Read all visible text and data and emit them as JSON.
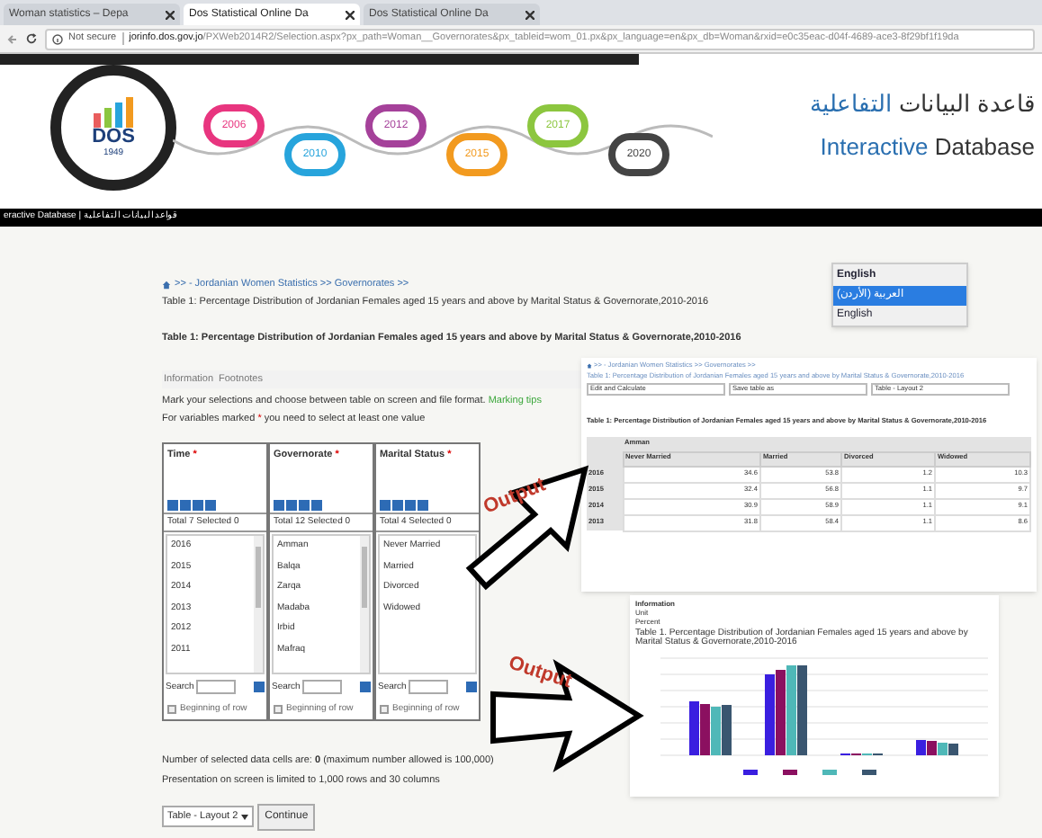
{
  "browser": {
    "tabs": [
      {
        "title": "Woman statistics – Depa",
        "selected": false
      },
      {
        "title": "Dos Statistical Online Da",
        "selected": true
      },
      {
        "title": "Dos Statistical Online Da",
        "selected": false
      }
    ],
    "security": "Not secure",
    "url_host": "jorinfo.dos.gov.jo",
    "url_path": "/PXWeb2014R2/Selection.aspx?px_path=Woman__Governorates&px_tableid=wom_01.px&px_language=en&px_db=Woman&rxid=e0c35eac-d04f-4689-ace3-8f29bf1f19da"
  },
  "banner": {
    "logo_text": "DOS",
    "logo_year": "1949",
    "years": [
      "2006",
      "2010",
      "2012",
      "2015",
      "2017",
      "2020"
    ],
    "title_ar_1": "قاعدة البيانات",
    "title_ar_2": "التفاعلية",
    "title_en_1": "Interactive",
    "title_en_2": "Database"
  },
  "nav_bar": "eractive Database | قواعد البيانات التفاعلية",
  "breadcrumb": ">> - Jordanian Women Statistics >> Governorates >>",
  "table_title_small": "Table 1: Percentage Distribution of Jordanian Females aged 15 years and above by Marital Status & Governorate,2010-2016",
  "table_title": "Table 1: Percentage Distribution of Jordanian Females aged 15 years and above by Marital Status & Governorate,2010-2016",
  "info_tabs": [
    "Information",
    "Footnotes"
  ],
  "instructions": {
    "text": "Mark your selections and choose between table on screen and file format.",
    "link": "Marking tips"
  },
  "required_note": {
    "before": "For variables marked",
    "mark": "*",
    "after": "you need to select at least one value"
  },
  "variables": [
    {
      "name": "Time",
      "mark": "*",
      "summary": "Total 7 Selected 0",
      "values": [
        "2016",
        "2015",
        "2014",
        "2013",
        "2012",
        "2011"
      ],
      "scrollbar": true,
      "search_label": "Search",
      "beginning_label": "Beginning of row",
      "beginning_checked": false
    },
    {
      "name": "Governorate",
      "mark": "*",
      "summary": "Total 12 Selected 0",
      "values": [
        "Amman",
        "Balqa",
        "Zarqa",
        "Madaba",
        "Irbid",
        "Mafraq"
      ],
      "scrollbar": true,
      "search_label": "Search",
      "beginning_label": "Beginning of row",
      "beginning_checked": false
    },
    {
      "name": "Marital Status",
      "mark": "*",
      "summary": "Total 4 Selected 0",
      "values": [
        "Never Married",
        "Married",
        "Divorced",
        "Widowed"
      ],
      "scrollbar": false,
      "search_label": "Search",
      "beginning_label": "Beginning of row",
      "beginning_checked": false
    }
  ],
  "cell_info": "Number of selected data cells are: **0** (maximum number allowed is 100,000)",
  "presentation_note": "Presentation on screen is limited to 1,000 rows and 30 columns",
  "layout_select": "Table - Layout 2",
  "continue_button": "Continue",
  "language": {
    "current": "English",
    "options": [
      {
        "label": "العربية (الأردن)",
        "highlighted": true
      },
      {
        "label": "English",
        "highlighted": false
      }
    ]
  },
  "output_labels": [
    "Output",
    "Output"
  ],
  "table_output": {
    "breadcrumb": ">> - Jordanian Women Statistics >> Governorates >>",
    "title_small": "Table 1: Percentage Distribution of Jordanian Females aged 15 years and above by Marital Status & Governorate,2010-2016",
    "selects": [
      "Edit and Calculate",
      "Save table as",
      "Table - Layout 2"
    ],
    "title": "Table 1: Percentage Distribution of Jordanian Females aged 15 years and above by Marital Status & Governorate,2010-2016",
    "group": "Amman",
    "columns": [
      "Never Married",
      "Married",
      "Divorced",
      "Widowed"
    ],
    "rows": [
      {
        "year": "2016",
        "values": [
          "34.6",
          "53.8",
          "1.2",
          "10.3"
        ]
      },
      {
        "year": "2015",
        "values": [
          "32.4",
          "56.8",
          "1.1",
          "9.7"
        ]
      },
      {
        "year": "2014",
        "values": [
          "30.9",
          "58.9",
          "1.1",
          "9.1"
        ]
      },
      {
        "year": "2013",
        "values": [
          "31.8",
          "58.4",
          "1.1",
          "8.6"
        ]
      }
    ]
  },
  "chart_output": {
    "info_label": "Information",
    "unit_label": "Unit",
    "unit_value": "Percent",
    "title": "Table 1. Percentage Distribution of Jordanian Females aged 15 years and above by Marital Status & Governorate,2010-2016"
  }
}
